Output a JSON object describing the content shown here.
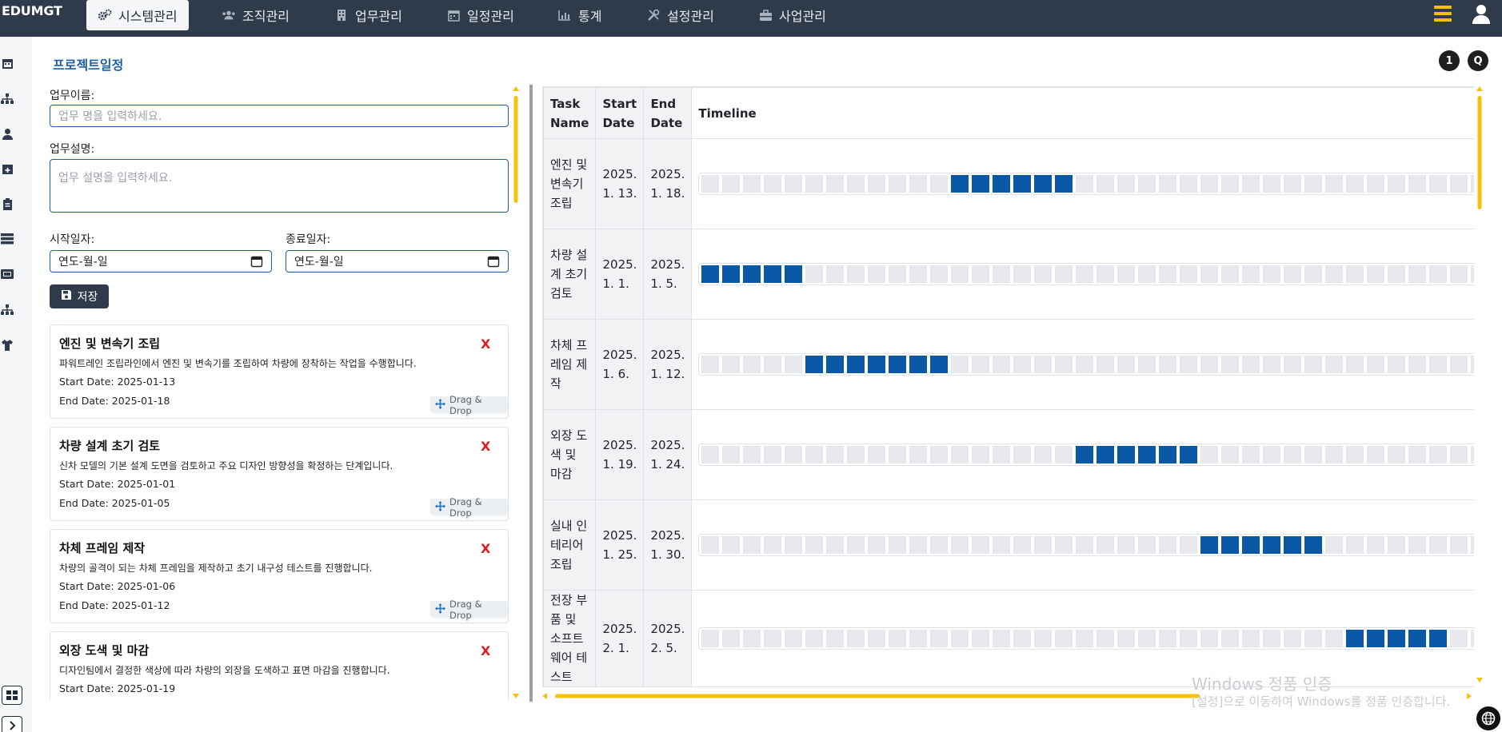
{
  "app": {
    "brand": "EDUMGT"
  },
  "nav": {
    "items": [
      {
        "label": "시스템관리",
        "icon": "gears-icon",
        "active": true
      },
      {
        "label": "조직관리",
        "icon": "users-icon"
      },
      {
        "label": "업무관리",
        "icon": "building-icon"
      },
      {
        "label": "일정관리",
        "icon": "calendar-icon"
      },
      {
        "label": "통계",
        "icon": "chart-icon"
      },
      {
        "label": "설정관리",
        "icon": "tools-icon"
      },
      {
        "label": "사업관리",
        "icon": "briefcase-icon"
      }
    ]
  },
  "header": {
    "title": "프로젝트일정",
    "btn1": "1",
    "btn2": "Q"
  },
  "form": {
    "name_label": "업무이름:",
    "name_placeholder": "업무 명을 입력하세요.",
    "desc_label": "업무설명:",
    "desc_placeholder": "업무 설명을 입력하세요.",
    "start_label": "시작일자:",
    "end_label": "종료일자:",
    "start_value": "연도-월-일",
    "end_value": "연도-월-일",
    "save_label": "저장"
  },
  "tasks": [
    {
      "title": "엔진 및 변속기 조립",
      "desc": "파워트레인 조립라인에서 엔진 및 변속기를 조립하여 차량에 장착하는 작업을 수행합니다.",
      "start": "Start Date: 2025-01-13",
      "end": "End Date: 2025-01-18"
    },
    {
      "title": "차량 설계 초기 검토",
      "desc": "신차 모델의 기본 설계 도면을 검토하고 주요 디자인 방향성을 확정하는 단계입니다.",
      "start": "Start Date: 2025-01-01",
      "end": "End Date: 2025-01-05"
    },
    {
      "title": "차체 프레임 제작",
      "desc": "차량의 골격이 되는 차체 프레임을 제작하고 초기 내구성 테스트를 진행합니다.",
      "start": "Start Date: 2025-01-06",
      "end": "End Date: 2025-01-12"
    },
    {
      "title": "외장 도색 및 마감",
      "desc": "디자인팀에서 결정한 색상에 따라 차량의 외장을 도색하고 표면 마감을 진행합니다.",
      "start": "Start Date: 2025-01-19",
      "end": ""
    }
  ],
  "card_labels": {
    "delete": "X",
    "drag": "Drag & Drop"
  },
  "timeline": {
    "headers": {
      "task": "Task Name",
      "start": "Start Date",
      "end": "End Date",
      "timeline": "Timeline"
    },
    "rows": [
      {
        "name": "엔진 및 변속기 조립",
        "start": "2025. 1. 13.",
        "end": "2025. 1. 18.",
        "from": 13,
        "to": 18
      },
      {
        "name": "차량 설계 초기 검토",
        "start": "2025. 1. 1.",
        "end": "2025. 1. 5.",
        "from": 1,
        "to": 5
      },
      {
        "name": "차체 프레임 제작",
        "start": "2025. 1. 6.",
        "end": "2025. 1. 12.",
        "from": 6,
        "to": 12
      },
      {
        "name": "외장 도색 및 마감",
        "start": "2025. 1. 19.",
        "end": "2025. 1. 24.",
        "from": 19,
        "to": 24
      },
      {
        "name": "실내 인테리어 조립",
        "start": "2025. 1. 25.",
        "end": "2025. 1. 30.",
        "from": 25,
        "to": 30
      },
      {
        "name": "전장 부품 및 소프트웨어 테스트",
        "start": "2025. 2. 1.",
        "end": "2025. 2. 5.",
        "from": 32,
        "to": 36
      }
    ]
  },
  "watermark": {
    "line1": "Windows 정품 인증",
    "line2": "[설정]으로 이동하여 Windows를 정품 인증합니다."
  },
  "colors": {
    "accent": "#0a57a6",
    "navbar": "#2f3a4a",
    "scrollbar": "#f4c20d",
    "delete": "#e01e1e"
  }
}
